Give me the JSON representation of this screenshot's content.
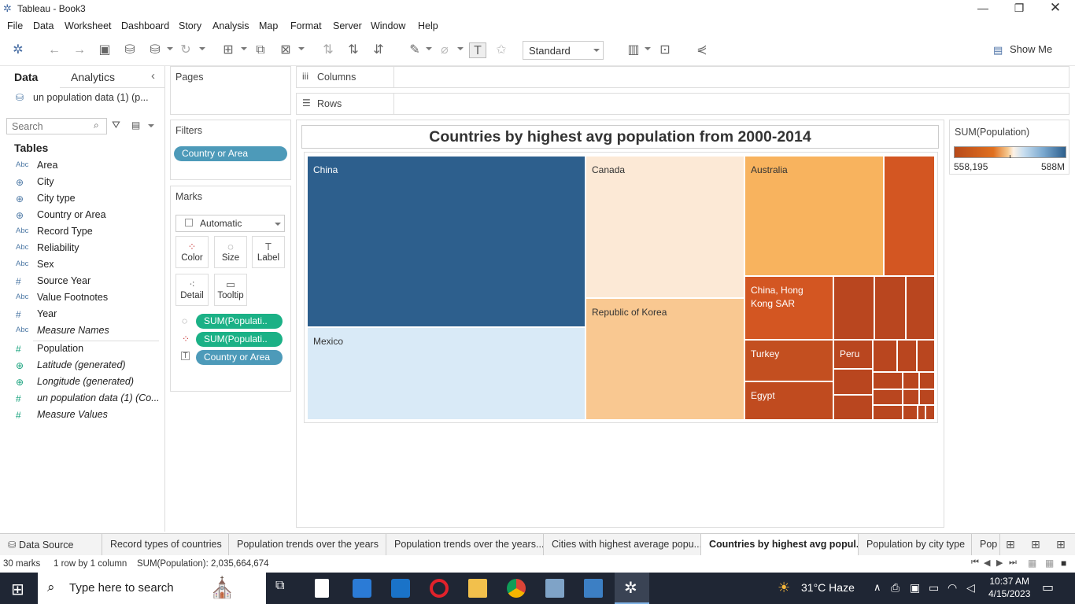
{
  "app": {
    "title": "Tableau - Book3",
    "menu": [
      "File",
      "Data",
      "Worksheet",
      "Dashboard",
      "Story",
      "Analysis",
      "Map",
      "Format",
      "Server",
      "Window",
      "Help"
    ]
  },
  "toolbar": {
    "fit_select": "Standard",
    "show_me": "Show Me"
  },
  "left_pane": {
    "tab_data": "Data",
    "tab_analytics": "Analytics",
    "datasource": "un population data (1) (p...",
    "search_placeholder": "Search",
    "tables_heading": "Tables",
    "fields": [
      {
        "type": "Abc",
        "name": "Area",
        "italic": false,
        "kind": "dim"
      },
      {
        "type": "globe",
        "name": "City",
        "italic": false,
        "kind": "dim"
      },
      {
        "type": "globe",
        "name": "City type",
        "italic": false,
        "kind": "dim"
      },
      {
        "type": "globe",
        "name": "Country or Area",
        "italic": false,
        "kind": "dim"
      },
      {
        "type": "Abc",
        "name": "Record Type",
        "italic": false,
        "kind": "dim"
      },
      {
        "type": "Abc",
        "name": "Reliability",
        "italic": false,
        "kind": "dim"
      },
      {
        "type": "Abc",
        "name": "Sex",
        "italic": false,
        "kind": "dim"
      },
      {
        "type": "#",
        "name": "Source Year",
        "italic": false,
        "kind": "dim"
      },
      {
        "type": "Abc",
        "name": "Value Footnotes",
        "italic": false,
        "kind": "dim"
      },
      {
        "type": "#",
        "name": "Year",
        "italic": false,
        "kind": "dim"
      },
      {
        "type": "Abc",
        "name": "Measure Names",
        "italic": true,
        "kind": "dim"
      },
      {
        "type": "#",
        "name": "Population",
        "italic": false,
        "kind": "meas"
      },
      {
        "type": "globe",
        "name": "Latitude (generated)",
        "italic": true,
        "kind": "meas"
      },
      {
        "type": "globe",
        "name": "Longitude (generated)",
        "italic": true,
        "kind": "meas"
      },
      {
        "type": "#",
        "name": "un population data (1) (Co...",
        "italic": true,
        "kind": "meas"
      },
      {
        "type": "#",
        "name": "Measure Values",
        "italic": true,
        "kind": "meas"
      }
    ]
  },
  "shelves": {
    "pages": "Pages",
    "filters": "Filters",
    "filter_pill": "Country or Area",
    "marks": "Marks",
    "mark_type": "Automatic",
    "mark_buttons": [
      "Color",
      "Size",
      "Label",
      "Detail",
      "Tooltip"
    ],
    "mark_pills": [
      "SUM(Populati..",
      "SUM(Populati..",
      "Country or Area"
    ],
    "columns": "Columns",
    "rows": "Rows"
  },
  "chart_data": {
    "type": "treemap",
    "title": "Countries by highest avg population from 2000-2014",
    "measure": "SUM(Population)",
    "color_range_labels": [
      "558,195",
      "588M"
    ],
    "labeled_items": [
      "China",
      "Mexico",
      "Canada",
      "Republic of Korea",
      "Australia",
      "China, Hong Kong SAR",
      "Turkey",
      "Egypt",
      "Peru"
    ]
  },
  "legend": {
    "title": "SUM(Population)",
    "min": "558,195",
    "max": "588M"
  },
  "sheet_tabs": [
    "Data Source",
    "Record types of countries",
    "Population trends over the years",
    "Population trends over the years...",
    "Cities with highest average popu...",
    "Countries by highest avg popul...",
    "Population by city type",
    "Pop"
  ],
  "status": {
    "marks": "30 marks",
    "dims": "1 row by 1 column",
    "sum": "SUM(Population): 2,035,664,674"
  },
  "taskbar": {
    "search": "Type here to search",
    "weather": "31°C  Haze",
    "time": "10:37 AM",
    "date": "4/15/2023"
  },
  "colors": {
    "blue_dark": "#2d5f8d",
    "blue_light": "#d9eaf7",
    "orange_peach": "#fce9d6",
    "orange_light": "#f9c891",
    "orange_mid": "#f8b35e",
    "orange_dark": "#d35622",
    "rust": "#b9461f"
  }
}
